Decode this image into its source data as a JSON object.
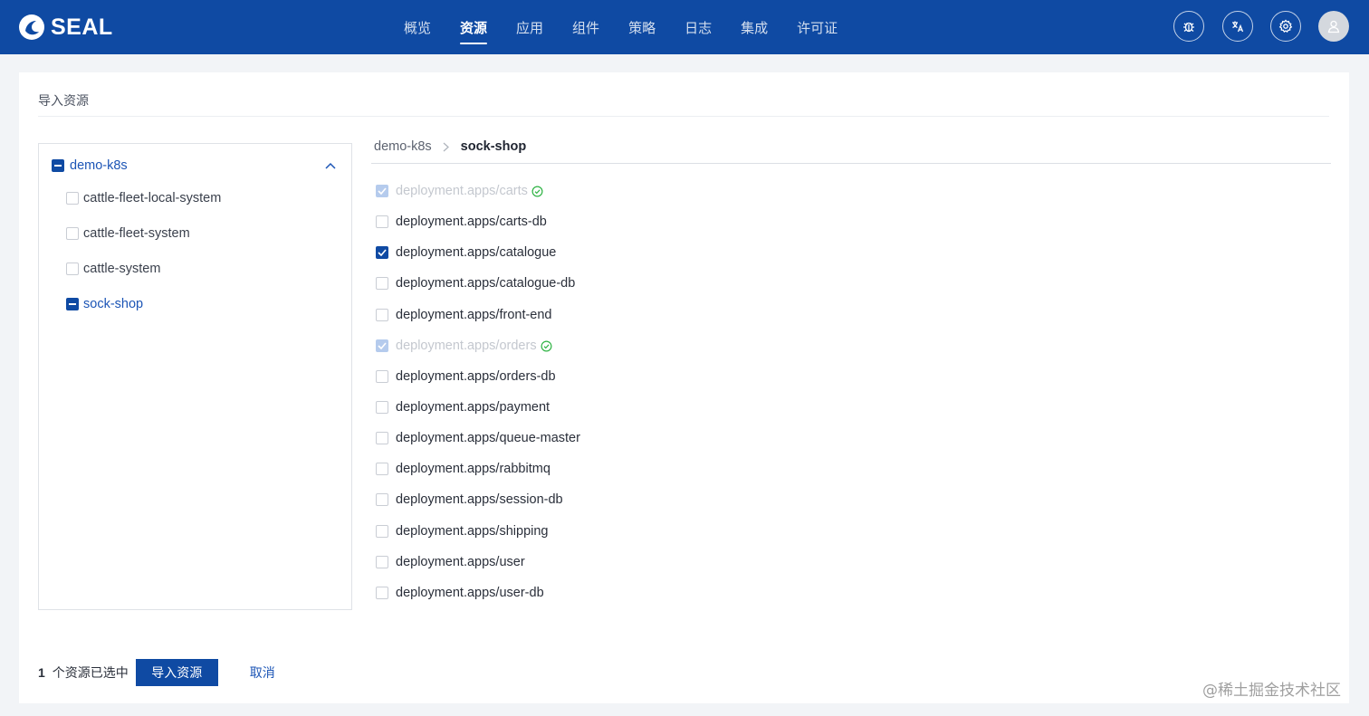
{
  "app": {
    "brand": "SEAL"
  },
  "nav": {
    "items": [
      {
        "label": "概览",
        "active": false
      },
      {
        "label": "资源",
        "active": true
      },
      {
        "label": "应用",
        "active": false
      },
      {
        "label": "组件",
        "active": false
      },
      {
        "label": "策略",
        "active": false
      },
      {
        "label": "日志",
        "active": false
      },
      {
        "label": "集成",
        "active": false
      },
      {
        "label": "许可证",
        "active": false
      }
    ]
  },
  "header_icons": [
    "bug-icon",
    "translate-icon",
    "settings-icon",
    "user-avatar-icon"
  ],
  "page": {
    "title": "导入资源"
  },
  "tree": {
    "root": {
      "label": "demo-k8s",
      "state": "indeterminate"
    },
    "children": [
      {
        "label": "cattle-fleet-local-system",
        "state": "unchecked"
      },
      {
        "label": "cattle-fleet-system",
        "state": "unchecked"
      },
      {
        "label": "cattle-system",
        "state": "unchecked"
      },
      {
        "label": "sock-shop",
        "state": "indeterminate",
        "active": true
      }
    ]
  },
  "breadcrumb": {
    "parent": "demo-k8s",
    "current": "sock-shop"
  },
  "resources": [
    {
      "label": "deployment.apps/carts",
      "state": "disabled",
      "imported": true
    },
    {
      "label": "deployment.apps/carts-db",
      "state": "unchecked"
    },
    {
      "label": "deployment.apps/catalogue",
      "state": "checked"
    },
    {
      "label": "deployment.apps/catalogue-db",
      "state": "unchecked"
    },
    {
      "label": "deployment.apps/front-end",
      "state": "unchecked"
    },
    {
      "label": "deployment.apps/orders",
      "state": "disabled",
      "imported": true
    },
    {
      "label": "deployment.apps/orders-db",
      "state": "unchecked"
    },
    {
      "label": "deployment.apps/payment",
      "state": "unchecked"
    },
    {
      "label": "deployment.apps/queue-master",
      "state": "unchecked"
    },
    {
      "label": "deployment.apps/rabbitmq",
      "state": "unchecked"
    },
    {
      "label": "deployment.apps/session-db",
      "state": "unchecked"
    },
    {
      "label": "deployment.apps/shipping",
      "state": "unchecked"
    },
    {
      "label": "deployment.apps/user",
      "state": "unchecked"
    },
    {
      "label": "deployment.apps/user-db",
      "state": "unchecked"
    }
  ],
  "footer": {
    "selected_count": "1",
    "selected_text": "个资源已选中",
    "import_label": "导入资源",
    "cancel_label": "取消"
  },
  "watermark": "@稀土掘金技术社区",
  "colors": {
    "brand": "#0f4aa3",
    "link": "#1c55b6",
    "success": "#2fb344"
  }
}
